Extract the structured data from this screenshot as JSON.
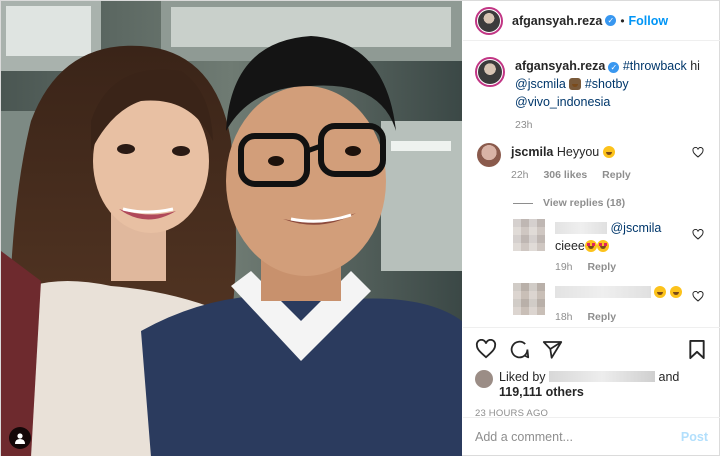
{
  "post": {
    "author": "afgansyah.reza",
    "follow_label": "Follow",
    "separator": "•"
  },
  "caption": {
    "username": "afgansyah.reza",
    "hashtag_throwback": "#throwback",
    "word_hi": "hi",
    "mention_jscmila": "@jscmila",
    "hashtag_shotby": "#shotby",
    "mention_vivo": "@vivo_indonesia",
    "time": "23h"
  },
  "comment": {
    "username": "jscmila",
    "text": "Heyyou",
    "time": "22h",
    "likes": "306 likes",
    "reply_label": "Reply",
    "view_replies": "View replies (18)"
  },
  "replies": [
    {
      "mention": "@jscmila",
      "text": "cieee",
      "time": "19h",
      "reply_label": "Reply"
    },
    {
      "time": "18h",
      "reply_label": "Reply"
    }
  ],
  "likes": {
    "prefix": "Liked by",
    "conjunction": "and",
    "others": "119,111 others",
    "timestamp": "23 HOURS AGO"
  },
  "composer": {
    "placeholder": "Add a comment...",
    "post_label": "Post"
  },
  "icons": {
    "heart": "heart-icon",
    "comment": "comment-icon",
    "share": "share-icon",
    "save": "bookmark-icon",
    "tag": "user-tag-icon",
    "verified": "verified-badge-icon"
  },
  "colors": {
    "link": "#00376b",
    "follow": "#0095f6",
    "muted": "#8e8e8e",
    "verified": "#3897f0",
    "post_disabled": "#b2dffc"
  }
}
